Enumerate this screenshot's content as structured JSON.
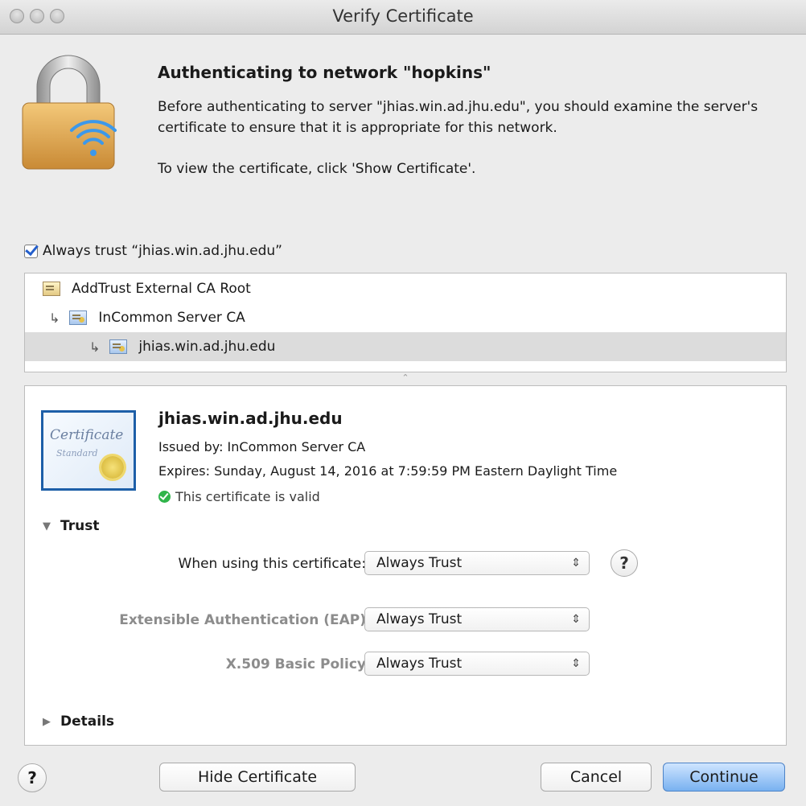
{
  "window": {
    "title": "Verify Certificate"
  },
  "header": {
    "title": "Authenticating to network \"hopkins\"",
    "description": "Before authenticating to server \"jhias.win.ad.jhu.edu\", you should examine the server's certificate to ensure that it is appropriate for this network.",
    "instruction": "To view the certificate, click 'Show Certificate'."
  },
  "always_trust": {
    "label": "Always trust “jhias.win.ad.jhu.edu”",
    "checked": true
  },
  "tree": {
    "items": [
      {
        "label": "AddTrust External CA Root"
      },
      {
        "label": "InCommon Server CA"
      },
      {
        "label": "jhias.win.ad.jhu.edu"
      }
    ]
  },
  "certificate": {
    "image_words": [
      "Certificate",
      "Standard"
    ],
    "name": "jhias.win.ad.jhu.edu",
    "issued_by": "Issued by: InCommon Server CA",
    "expires": "Expires: Sunday, August 14, 2016 at 7:59:59 PM Eastern Daylight Time",
    "status": "This certificate is valid"
  },
  "trust": {
    "section_label": "Trust",
    "rows": [
      {
        "label": "When using this certificate:",
        "value": "Always Trust"
      },
      {
        "label": "Extensible Authentication (EAP)",
        "value": "Always Trust"
      },
      {
        "label": "X.509 Basic Policy",
        "value": "Always Trust"
      }
    ],
    "help_label": "?"
  },
  "details": {
    "section_label": "Details"
  },
  "buttons": {
    "help": "?",
    "hide_certificate": "Hide Certificate",
    "cancel": "Cancel",
    "continue": "Continue"
  },
  "colors": {
    "accent": "#78b1f0",
    "valid": "#2fb44a",
    "cert_border": "#1d5fa8"
  }
}
